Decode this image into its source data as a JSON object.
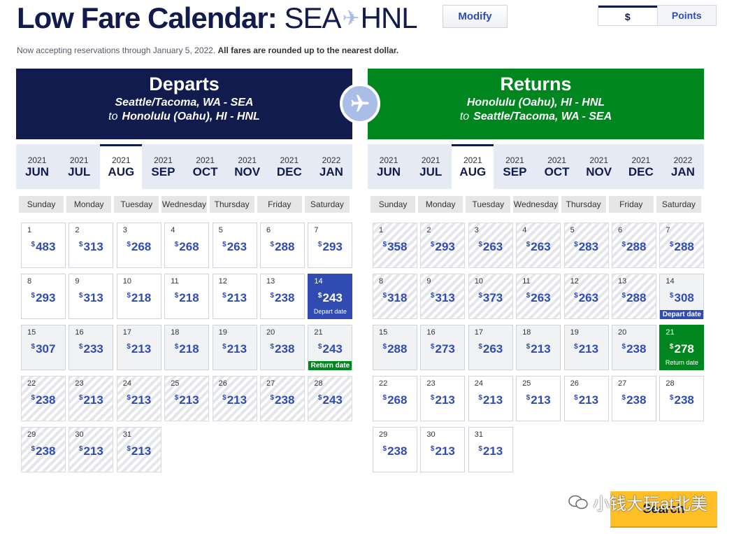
{
  "header": {
    "title_bold": "Low Fare Calendar:",
    "origin": "SEA",
    "destination": "HNL",
    "modify_label": "Modify",
    "toggle": {
      "dollars": "$",
      "points": "Points"
    },
    "notice": "Now accepting reservations through January 5, 2022.",
    "notice_bold": "All fares are rounded up to the nearest dollar."
  },
  "weekdays": [
    "Sunday",
    "Monday",
    "Tuesday",
    "Wednesday",
    "Thursday",
    "Friday",
    "Saturday"
  ],
  "months": [
    {
      "year": "2021",
      "month": "JUN"
    },
    {
      "year": "2021",
      "month": "JUL"
    },
    {
      "year": "2021",
      "month": "AUG"
    },
    {
      "year": "2021",
      "month": "SEP"
    },
    {
      "year": "2021",
      "month": "OCT"
    },
    {
      "year": "2021",
      "month": "NOV"
    },
    {
      "year": "2021",
      "month": "DEC"
    },
    {
      "year": "2022",
      "month": "JAN"
    }
  ],
  "currency_symbol": "$",
  "departs": {
    "title": "Departs",
    "from": "Seattle/Tacoma, WA - SEA",
    "to_word": "to",
    "to": "Honolulu (Oahu), HI - HNL",
    "selected_month": "AUG",
    "days": [
      {
        "day": "1",
        "price": "483",
        "state": "normal"
      },
      {
        "day": "2",
        "price": "313",
        "state": "normal"
      },
      {
        "day": "3",
        "price": "268",
        "state": "normal"
      },
      {
        "day": "4",
        "price": "268",
        "state": "normal"
      },
      {
        "day": "5",
        "price": "263",
        "state": "normal"
      },
      {
        "day": "6",
        "price": "288",
        "state": "normal"
      },
      {
        "day": "7",
        "price": "293",
        "state": "normal"
      },
      {
        "day": "8",
        "price": "293",
        "state": "normal"
      },
      {
        "day": "9",
        "price": "313",
        "state": "normal"
      },
      {
        "day": "10",
        "price": "218",
        "state": "normal"
      },
      {
        "day": "11",
        "price": "218",
        "state": "normal"
      },
      {
        "day": "12",
        "price": "213",
        "state": "normal"
      },
      {
        "day": "13",
        "price": "238",
        "state": "normal"
      },
      {
        "day": "14",
        "price": "243",
        "state": "selected",
        "sub": "Depart date"
      },
      {
        "day": "15",
        "price": "307",
        "state": "gray"
      },
      {
        "day": "16",
        "price": "233",
        "state": "gray"
      },
      {
        "day": "17",
        "price": "213",
        "state": "gray"
      },
      {
        "day": "18",
        "price": "218",
        "state": "gray"
      },
      {
        "day": "19",
        "price": "213",
        "state": "gray"
      },
      {
        "day": "20",
        "price": "238",
        "state": "gray"
      },
      {
        "day": "21",
        "price": "243",
        "state": "gray",
        "badge": "Return date"
      },
      {
        "day": "22",
        "price": "238",
        "state": "past"
      },
      {
        "day": "23",
        "price": "213",
        "state": "past"
      },
      {
        "day": "24",
        "price": "213",
        "state": "past"
      },
      {
        "day": "25",
        "price": "213",
        "state": "past"
      },
      {
        "day": "26",
        "price": "213",
        "state": "past"
      },
      {
        "day": "27",
        "price": "238",
        "state": "past"
      },
      {
        "day": "28",
        "price": "243",
        "state": "past"
      },
      {
        "day": "29",
        "price": "238",
        "state": "past"
      },
      {
        "day": "30",
        "price": "213",
        "state": "past"
      },
      {
        "day": "31",
        "price": "213",
        "state": "past"
      }
    ]
  },
  "returns": {
    "title": "Returns",
    "from": "Honolulu (Oahu), HI - HNL",
    "to_word": "to",
    "to": "Seattle/Tacoma, WA - SEA",
    "selected_month": "AUG",
    "days": [
      {
        "day": "1",
        "price": "358",
        "state": "past"
      },
      {
        "day": "2",
        "price": "293",
        "state": "past"
      },
      {
        "day": "3",
        "price": "263",
        "state": "past"
      },
      {
        "day": "4",
        "price": "263",
        "state": "past"
      },
      {
        "day": "5",
        "price": "283",
        "state": "past"
      },
      {
        "day": "6",
        "price": "288",
        "state": "past"
      },
      {
        "day": "7",
        "price": "288",
        "state": "past"
      },
      {
        "day": "8",
        "price": "318",
        "state": "past"
      },
      {
        "day": "9",
        "price": "313",
        "state": "past"
      },
      {
        "day": "10",
        "price": "373",
        "state": "past"
      },
      {
        "day": "11",
        "price": "263",
        "state": "past"
      },
      {
        "day": "12",
        "price": "263",
        "state": "past"
      },
      {
        "day": "13",
        "price": "288",
        "state": "past"
      },
      {
        "day": "14",
        "price": "308",
        "state": "gray",
        "badge": "Depart date",
        "badge_color": "blue"
      },
      {
        "day": "15",
        "price": "288",
        "state": "gray"
      },
      {
        "day": "16",
        "price": "273",
        "state": "gray"
      },
      {
        "day": "17",
        "price": "263",
        "state": "gray"
      },
      {
        "day": "18",
        "price": "213",
        "state": "gray"
      },
      {
        "day": "19",
        "price": "213",
        "state": "gray"
      },
      {
        "day": "20",
        "price": "238",
        "state": "gray"
      },
      {
        "day": "21",
        "price": "278",
        "state": "selected",
        "sub": "Return date"
      },
      {
        "day": "22",
        "price": "268",
        "state": "normal"
      },
      {
        "day": "23",
        "price": "213",
        "state": "normal"
      },
      {
        "day": "24",
        "price": "213",
        "state": "normal"
      },
      {
        "day": "25",
        "price": "213",
        "state": "normal"
      },
      {
        "day": "26",
        "price": "213",
        "state": "normal"
      },
      {
        "day": "27",
        "price": "238",
        "state": "normal"
      },
      {
        "day": "28",
        "price": "238",
        "state": "normal"
      },
      {
        "day": "29",
        "price": "238",
        "state": "normal"
      },
      {
        "day": "30",
        "price": "213",
        "state": "normal"
      },
      {
        "day": "31",
        "price": "213",
        "state": "normal"
      }
    ]
  },
  "search_label": "Search",
  "watermark": "小钱大玩at北美",
  "colors": {
    "navy": "#111b4e",
    "green": "#00861e",
    "blue": "#304cb2",
    "yellow": "#ffbf27"
  }
}
